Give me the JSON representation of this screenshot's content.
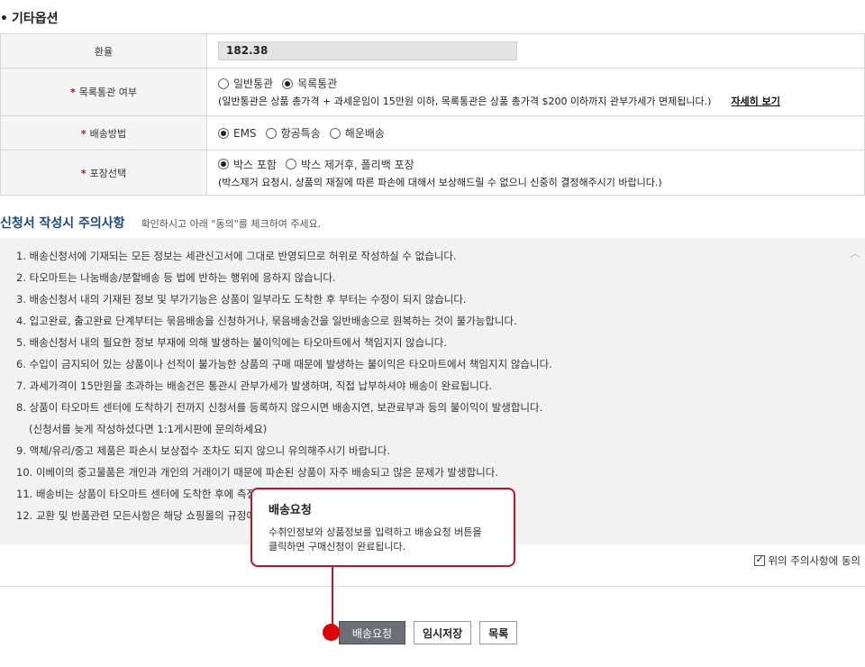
{
  "section": {
    "title": "기타옵션"
  },
  "options": {
    "rate": {
      "label": "환율",
      "value": "182.38"
    },
    "customs": {
      "label": "목록통관 여부",
      "options": [
        {
          "label": "일반통관",
          "selected": false
        },
        {
          "label": "목록통관",
          "selected": true
        }
      ],
      "note": "(일반통관은 상품 총가격 + 과세운임이 15만원 이하, 목록통관은 상품 총가격 $200 이하까지 관부가세가 면제됩니다.)",
      "link": "자세히 보기"
    },
    "shipping": {
      "label": "배송방법",
      "options": [
        {
          "label": "EMS",
          "selected": true
        },
        {
          "label": "항공특송",
          "selected": false
        },
        {
          "label": "해운배송",
          "selected": false
        }
      ]
    },
    "packing": {
      "label": "포장선택",
      "options": [
        {
          "label": "박스 포함",
          "selected": true
        },
        {
          "label": "박스 제거후, 폴리백 포장",
          "selected": false
        }
      ],
      "note": "(박스제거 요청시, 상품의 재질에 따른 파손에 대해서 보상해드릴 수 없으니 신중히 결정해주시기 바랍니다.)"
    }
  },
  "notice": {
    "title": "신청서 작성시 주의사항",
    "subtitle": "확인하시고 아래 \"동의\"를 체크하여 주세요.",
    "items": [
      "1. 배송신청서에 기재되는 모든 정보는 세관신고서에 그대로 반영되므로 허위로 작성하실 수 없습니다.",
      "2. 타오마트는 나눔배송/분할배송 등 법에 반하는 행위에 응하지 않습니다.",
      "3. 배송신청서 내의 기재된 정보 및 부가기능은 상품이 일부라도 도착한 후 부터는 수정이 되지 않습니다.",
      "4. 입고완료, 출고완료 단계부터는 묶음배송을 신청하거나, 묶음배송건을 일반배송으로 원복하는 것이 불가능합니다.",
      "5. 배송신청서 내의 필요한 정보 부재에 의해 발생하는 불이익에는 타오마트에서 책임지지 않습니다.",
      "6. 수입이 금지되어 있는 상품이나 선적이 불가능한 상품의 구매 때문에 발생하는 불이익은 타오마트에서 책임지지 않습니다.",
      "7. 과세가격이 15만원을 초과하는 배송건은 통관시 관부가세가 발생하며, 직접 납부하셔야 배송이 완료됩니다.",
      "8. 상품이 타오마트 센터에 도착하기 전까지 신청서를 등록하지 않으시면 배송지연, 보관료부과 등의 불이익이 발생합니다.",
      "(신청서를 늦게 작성하셨다면 1:1게시판에 문의하세요)",
      "9. 액체/유리/중고 제품은 파손시 보상접수 조차도 되지 않으니 유의해주시기 바랍니다.",
      "10. 이베이의 중고물품은 개인과 개인의 거래이기 때문에 파손된 상품이 자주 배송되고 많은 문제가 발생합니다.",
      "11. 배송비는 상품이 타오마트 센터에 도착한 후에 측정됩니다.",
      "12. 교환 및 반품관련 모든사항은 해당 쇼핑몰의 규정에 따릅니다."
    ]
  },
  "agree": {
    "label": "위의 주의사항에 동의",
    "checked": true
  },
  "buttons": {
    "submit": "배송요청",
    "save": "임시저장",
    "list": "목록"
  },
  "tooltip": {
    "title": "배송요청",
    "line1": "수취인정보와 상품정보를 입력하고 배송요청 버튼을",
    "line2": "클릭하면 구매신청이 완료됩니다."
  },
  "colors": {
    "accent": "#c8102e",
    "notice_title": "#1a4a86",
    "primary_button": "#6a6f78"
  }
}
